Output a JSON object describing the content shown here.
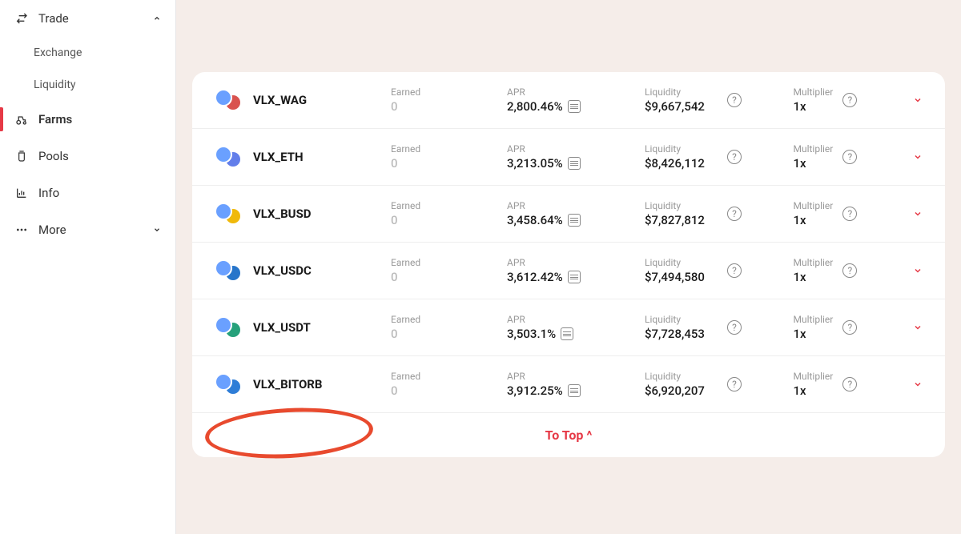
{
  "sidebar": {
    "trade": {
      "label": "Trade",
      "expanded": true,
      "items": [
        "Exchange",
        "Liquidity"
      ]
    },
    "farms": "Farms",
    "pools": "Pools",
    "info": "Info",
    "more": "More"
  },
  "columns": {
    "earned": "Earned",
    "apr": "APR",
    "liquidity": "Liquidity",
    "multiplier": "Multiplier"
  },
  "farms": [
    {
      "pair": "VLX_WAG",
      "earned": "0",
      "apr": "2,800.46%",
      "liquidity": "$9,667,542",
      "multiplier": "1x",
      "coinB": "#d9534f"
    },
    {
      "pair": "VLX_ETH",
      "earned": "0",
      "apr": "3,213.05%",
      "liquidity": "$8,426,112",
      "multiplier": "1x",
      "coinB": "#627eea"
    },
    {
      "pair": "VLX_BUSD",
      "earned": "0",
      "apr": "3,458.64%",
      "liquidity": "$7,827,812",
      "multiplier": "1x",
      "coinB": "#f0b90b"
    },
    {
      "pair": "VLX_USDC",
      "earned": "0",
      "apr": "3,612.42%",
      "liquidity": "$7,494,580",
      "multiplier": "1x",
      "coinB": "#2775ca"
    },
    {
      "pair": "VLX_USDT",
      "earned": "0",
      "apr": "3,503.1%",
      "liquidity": "$7,728,453",
      "multiplier": "1x",
      "coinB": "#26a17b"
    },
    {
      "pair": "VLX_BITORB",
      "earned": "0",
      "apr": "3,912.25%",
      "liquidity": "$6,920,207",
      "multiplier": "1x",
      "coinB": "#2e7dd7"
    }
  ],
  "toTop": "To Top"
}
